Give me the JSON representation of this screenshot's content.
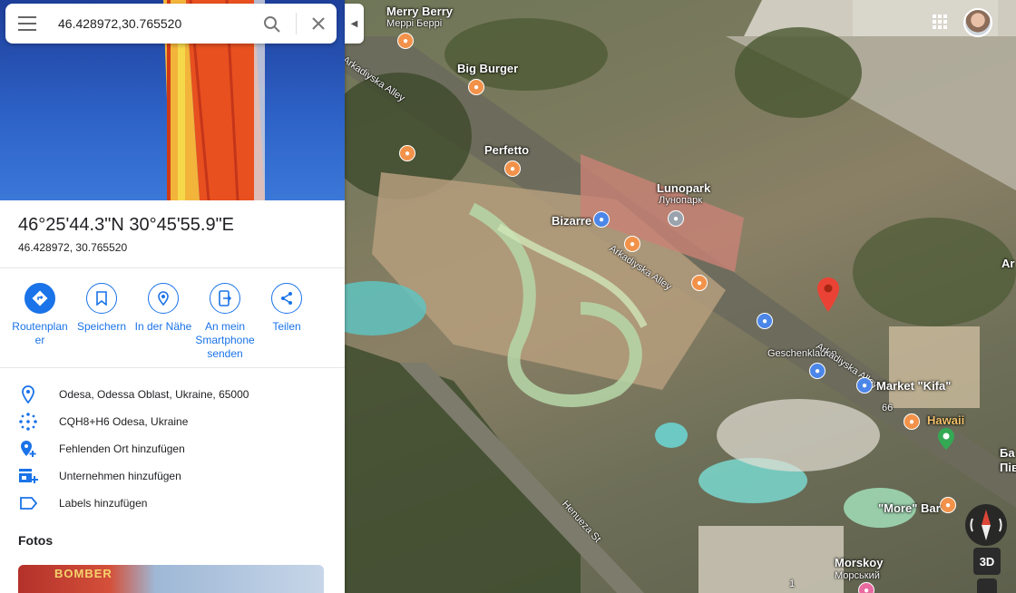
{
  "search": {
    "value": "46.428972,30.765520"
  },
  "place": {
    "title": "46°25'44.3\"N 30°45'55.9\"E",
    "decimal": "46.428972, 30.765520"
  },
  "actions": [
    {
      "label": "Routenplaner",
      "icon": "directions-icon"
    },
    {
      "label": "Speichern",
      "icon": "bookmark-icon"
    },
    {
      "label": "In der Nähe",
      "icon": "nearby-icon"
    },
    {
      "label": "An mein Smartphone senden",
      "icon": "send-to-phone-icon"
    },
    {
      "label": "Teilen",
      "icon": "share-icon"
    }
  ],
  "info": [
    {
      "text": "Odesa, Odessa Oblast, Ukraine, 65000",
      "icon": "location-pin-icon"
    },
    {
      "text": "CQH8+H6 Odesa, Ukraine",
      "icon": "plus-code-icon"
    },
    {
      "text": "Fehlenden Ort hinzufügen",
      "icon": "add-place-icon"
    },
    {
      "text": "Unternehmen hinzufügen",
      "icon": "add-business-icon"
    },
    {
      "text": "Labels hinzufügen",
      "icon": "label-icon"
    }
  ],
  "photos": {
    "title": "Fotos",
    "thumb_text": "BOMBER"
  },
  "map": {
    "labels": {
      "merry_berry": "Merry Berry",
      "merry_berry_ru": "Меррі Беррі",
      "big_burger": "Big Burger",
      "perfetto": "Perfetto",
      "lunopark": "Lunopark",
      "lunopark_ru": "Лунопарк",
      "bizarre": "Bizarre",
      "geschenkladen": "Geschenkladen",
      "market_kifa": "Market \"Kifa\"",
      "hawaii": "Hawaii",
      "more_bar": "\"More\" Bar",
      "morskoy": "Morskoy",
      "morskoy_ru": "Морський",
      "arkadiyska_1": "Arkadiyska Alley",
      "arkadiyska_2": "Arkadiyska Alley",
      "arkadiyska_3": "Arkadiyska Alley",
      "henueza": "Henueza St",
      "ar": "Ar",
      "ba": "Ба",
      "pi": "Пів",
      "num66": "66",
      "num1": "1"
    },
    "btn_3d": "3D"
  },
  "colors": {
    "accent": "#1a73e8",
    "pin": "#ea4335"
  }
}
